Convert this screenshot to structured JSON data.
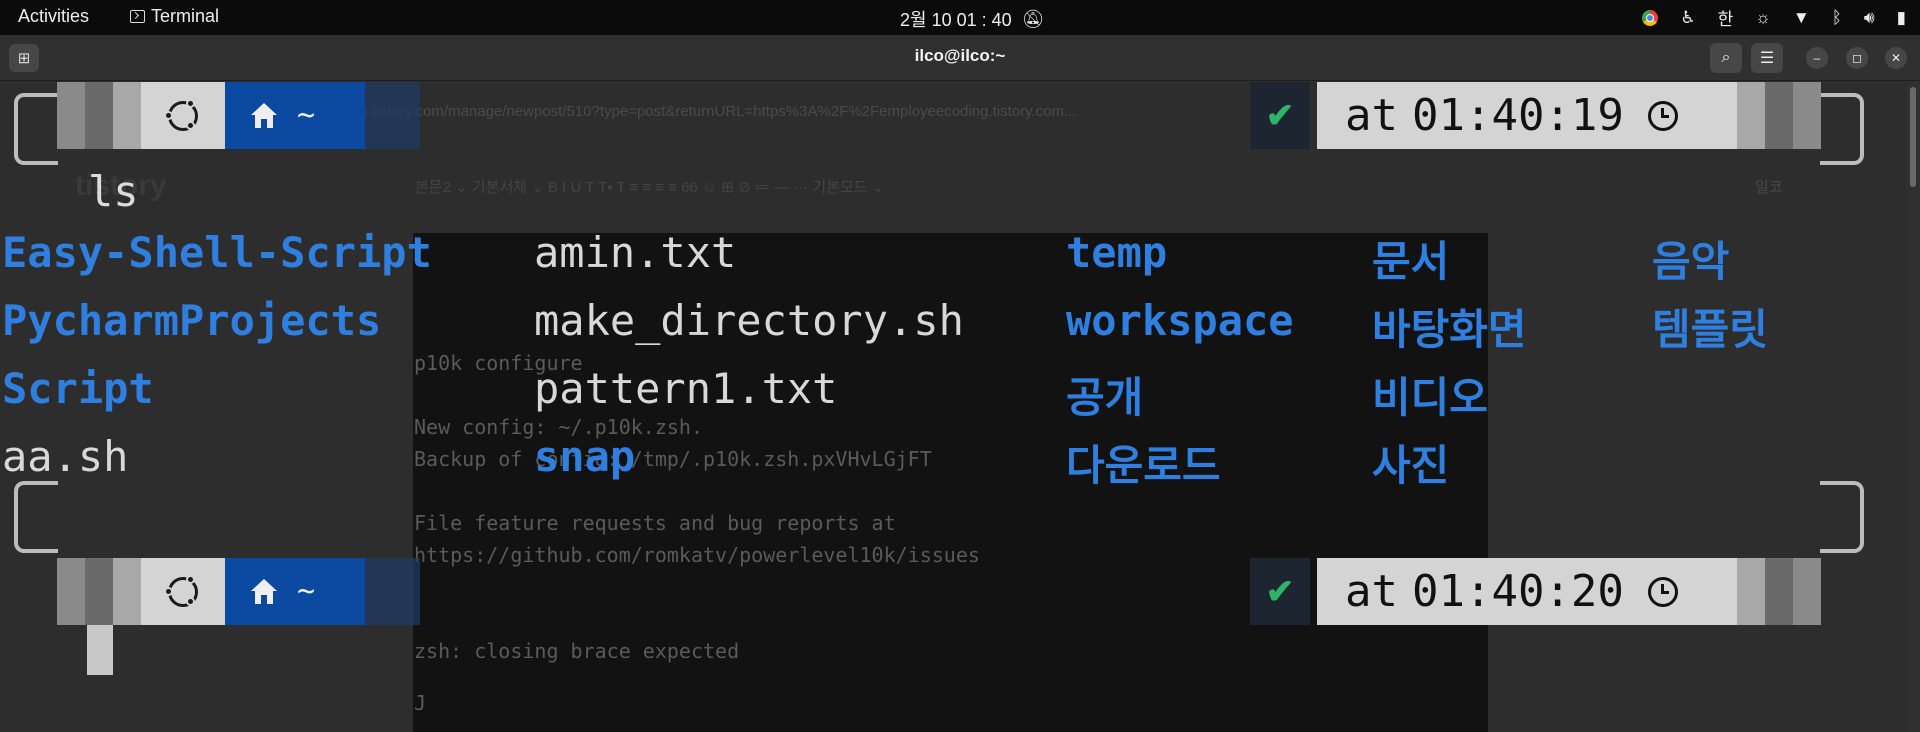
{
  "topbar": {
    "activities": "Activities",
    "app_name": "Terminal",
    "clock": "2월 10  01 : 40",
    "tray_lang": "한"
  },
  "terminal": {
    "title": "ilco@ilco:~"
  },
  "background_ghost": {
    "url": "p.tistory.com/manage/newpost/510?type=post&returnURL=https%3A%2F%2Femployeecoding.tistory.com...",
    "logo": "tistory",
    "toolbar": "본문2 ⌄   기본서체 ⌄      B   I   U   T   T▪   T        ≡   ≡   ≡   ≡      66   ☺   ⊞   ⊘   ≔   —   ···          기본모드 ⌄",
    "lines": [
      "p10k configure",
      "New config: ~/.p10k.zsh.",
      "Backup of      config: /tmp/.p10k.zsh.pxVHvLGjFT",
      "File feature requests and bug reports at",
      "https://github.com/romkatv/powerlevel10k/issues",
      "zsh: closing brace expected",
      "J"
    ],
    "user": "일코"
  },
  "prompt1": {
    "dir": "~",
    "status": "✔",
    "time_prefix": "at",
    "time": "01:40:19"
  },
  "prompt2": {
    "dir": "~",
    "status": "✔",
    "time_prefix": "at",
    "time": "01:40:20"
  },
  "command": "ls",
  "listing": {
    "col1": [
      "Easy-Shell-Script",
      "PycharmProjects",
      "Script",
      "aa.sh"
    ],
    "col2": [
      "amin.txt",
      "make_directory.sh",
      "pattern1.txt",
      "snap"
    ],
    "col3": [
      "temp",
      "workspace",
      "공개",
      "다운로드"
    ],
    "col4": [
      "문서",
      "바탕화면",
      "비디오",
      "사진"
    ],
    "col5": [
      "음악",
      "템플릿"
    ]
  },
  "colors": {
    "directory": "#2f7fe0",
    "file": "#d8d8d8",
    "dir_segment": "#0b4aa0",
    "ok": "#2fb36b"
  }
}
